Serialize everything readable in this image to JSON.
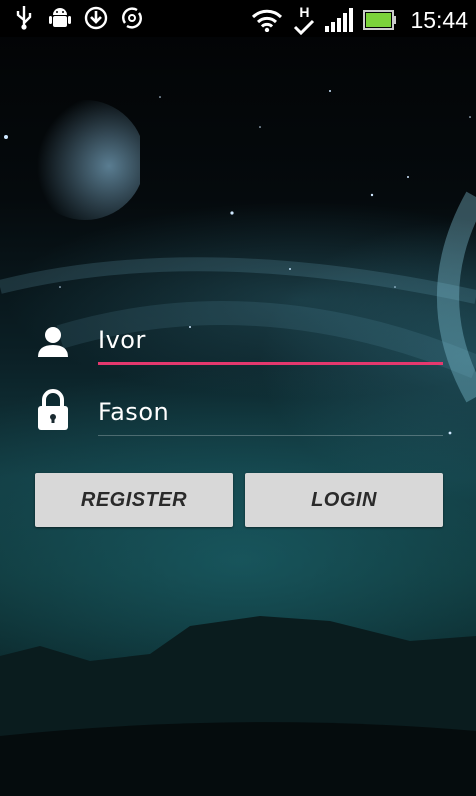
{
  "status_bar": {
    "time": "15:44",
    "network_type": "H",
    "left_icons": [
      "usb-icon",
      "android-debug-icon",
      "download-icon",
      "sync-icon"
    ],
    "right_icons": [
      "wifi-icon",
      "network-h-icon",
      "signal-icon",
      "battery-icon"
    ],
    "battery_color": "#7cd23a"
  },
  "form": {
    "username": {
      "value": "Ivor",
      "icon": "user-icon",
      "underline_color": "#e4386e"
    },
    "password": {
      "value": "Fason",
      "icon": "lock-icon"
    },
    "register_label": "REGISTER",
    "login_label": "LOGIN"
  }
}
